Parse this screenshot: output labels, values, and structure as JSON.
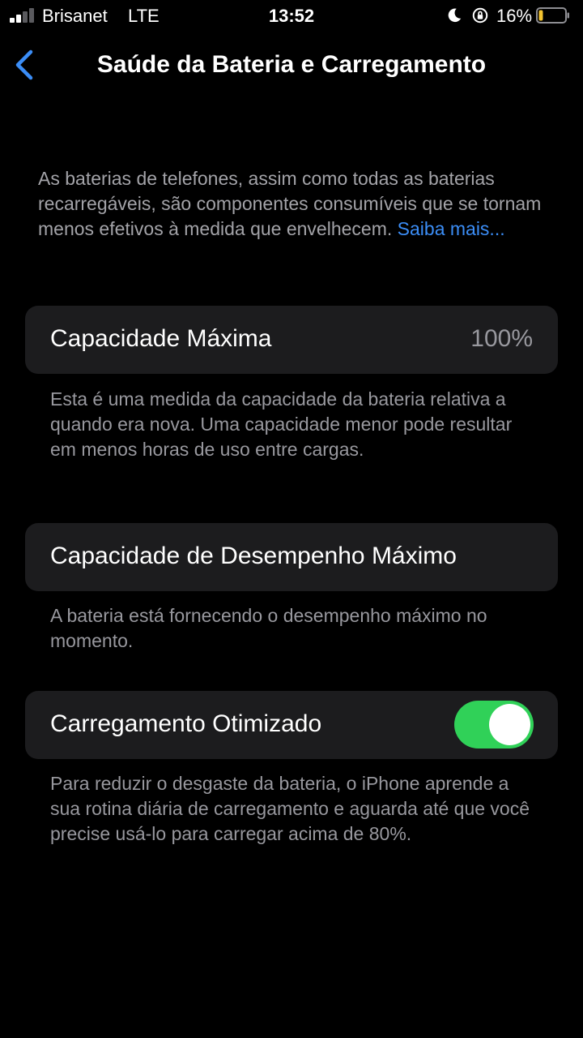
{
  "status_bar": {
    "carrier": "Brisanet",
    "network": "LTE",
    "time": "13:52",
    "battery_percent": "16%",
    "signal_bars": 2,
    "battery_level": 0.16,
    "battery_color": "#f4c430"
  },
  "nav": {
    "back_icon": "chevron-left-icon",
    "title": "Saúde da Bateria e Carregamento"
  },
  "intro": {
    "text": "As baterias de telefones, assim como todas as baterias recarregáveis, são componentes consumíveis que se tornam menos efetivos à medida que envelhecem. ",
    "link_text": "Saiba mais..."
  },
  "max_capacity": {
    "label": "Capacidade Máxima",
    "value": "100%",
    "footer": "Esta é uma medida da capacidade da bateria relativa a quando era nova. Uma capacidade menor pode resultar em menos horas de uso entre cargas."
  },
  "peak_performance": {
    "label": "Capacidade de Desempenho Máximo",
    "footer": "A bateria está fornecendo o desempenho máximo no momento."
  },
  "optimized_charging": {
    "label": "Carregamento Otimizado",
    "enabled": true,
    "footer": "Para reduzir o desgaste da bateria, o iPhone aprende a sua rotina diária de carregamento e aguarda até que você precise usá-lo para carregar acima de 80%."
  },
  "colors": {
    "accent_link": "#3b8df6",
    "toggle_on": "#30d158",
    "card_bg": "#1c1c1e"
  }
}
